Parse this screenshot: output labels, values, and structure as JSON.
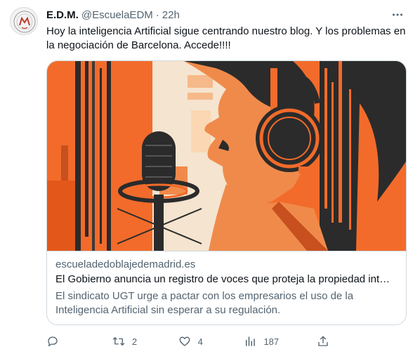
{
  "tweet": {
    "author_name": "E.D.M.",
    "author_handle": "@EscuelaEDM",
    "separator": "·",
    "time": "22h",
    "text": "Hoy la inteligencia Artificial sigue centrando nuestro blog. Y los problemas en la negociación de Barcelona. Accede!!!!",
    "more_icon": "more-horizontal-icon"
  },
  "card": {
    "domain": "escueladedoblajedemadrid.es",
    "title": "El Gobierno anuncia un registro de voces que proteja la propiedad int…",
    "description": "El sindicato UGT urge a pactar con los empresarios el uso de la Inteligencia Artificial sin esperar a su regulación.",
    "image_subject": "illustration of a man with headphones singing into a studio microphone",
    "colors": {
      "orange": "#f26b2a",
      "dark": "#2b2b2b",
      "cream": "#f5e9da",
      "skin": "#f08a4b"
    }
  },
  "actions": {
    "reply": {
      "icon": "reply-icon",
      "count": ""
    },
    "retweet": {
      "icon": "retweet-icon",
      "count": "2"
    },
    "like": {
      "icon": "heart-icon",
      "count": "4"
    },
    "views": {
      "icon": "views-chart-icon",
      "count": "187"
    },
    "share": {
      "icon": "share-icon",
      "count": ""
    }
  },
  "colors": {
    "text_primary": "#0f1419",
    "text_secondary": "#536471",
    "border": "#cfd9de"
  }
}
